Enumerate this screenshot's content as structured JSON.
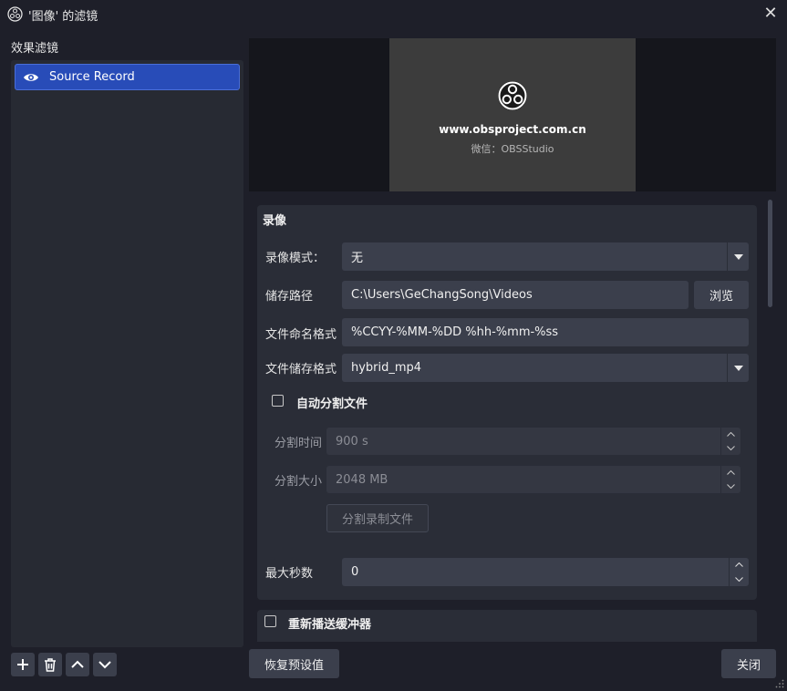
{
  "window": {
    "title": "'图像' 的滤镜"
  },
  "sidebar": {
    "label": "效果滤镜",
    "filters": [
      {
        "label": "Source Record"
      }
    ]
  },
  "preview": {
    "url": "www.obsproject.com.cn",
    "wechat": "微信：OBSStudio"
  },
  "recording": {
    "group_title": "录像",
    "mode_label": "录像模式：",
    "mode_value": "无",
    "path_label": "储存路径",
    "path_value": "C:\\Users\\GeChangSong\\Videos",
    "browse_label": "浏览",
    "naming_label": "文件命名格式",
    "naming_value": "%CCYY-%MM-%DD %hh-%mm-%ss",
    "format_label": "文件储存格式",
    "format_value": "hybrid_mp4",
    "auto_split_label": "自动分割文件",
    "split_time_label": "分割时间",
    "split_time_value": "900 s",
    "split_size_label": "分割大小",
    "split_size_value": "2048 MB",
    "split_button_label": "分割录制文件",
    "max_seconds_label": "最大秒数",
    "max_seconds_value": "0"
  },
  "replay": {
    "label": "重新播送缓冲器"
  },
  "footer": {
    "reset_label": "恢复预设值",
    "close_label": "关闭"
  },
  "colors": {
    "accent": "#284cb8",
    "background": "#1e1f29",
    "panel": "#2a2d37",
    "field": "#3b3f4c"
  }
}
